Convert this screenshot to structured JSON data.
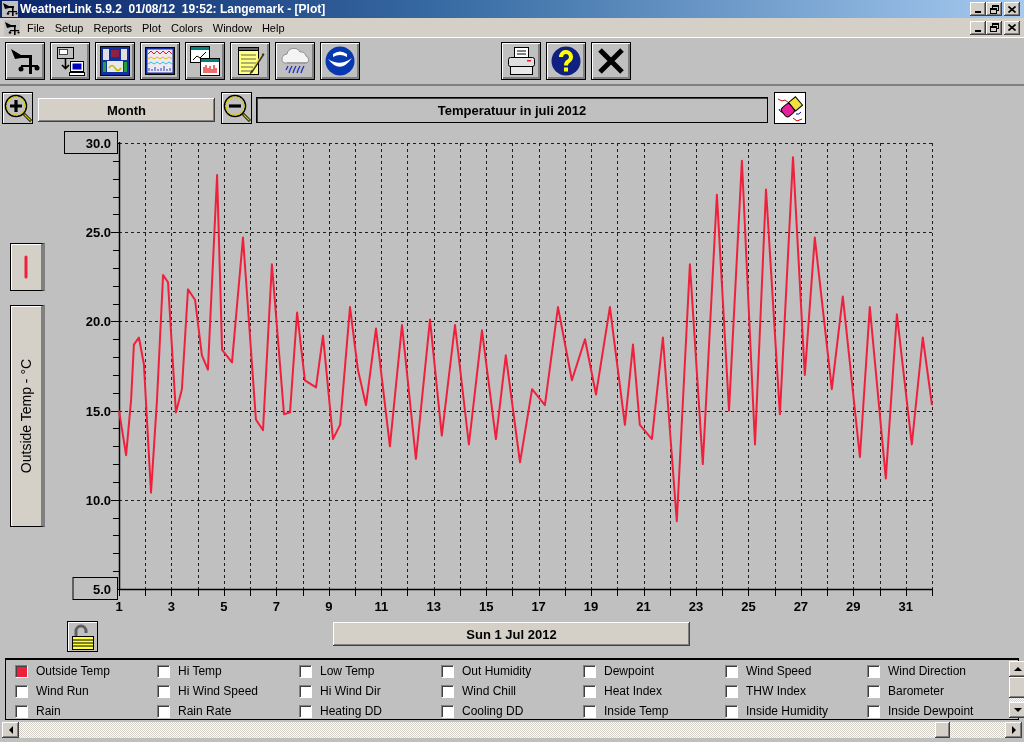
{
  "window": {
    "title": "WeatherLink 5.9.2  01/08/12  19:52: Langemark - [Plot]"
  },
  "menu": {
    "items": [
      "File",
      "Setup",
      "Reports",
      "Plot",
      "Colors",
      "Window",
      "Help"
    ]
  },
  "plot_controls": {
    "period_button": {
      "label": "Month"
    },
    "title_field": {
      "value": "Temperatuur in juli 2012"
    }
  },
  "chart": {
    "chart_data": {
      "type": "line",
      "ylabel": "Outside Temp - °C",
      "grid": true,
      "x": [
        1.0,
        1.27,
        1.46,
        1.57,
        1.76,
        1.95,
        2.22,
        2.45,
        2.68,
        2.87,
        3.17,
        3.4,
        3.63,
        3.9,
        4.16,
        4.39,
        4.74,
        4.93,
        5.31,
        5.73,
        6.22,
        6.49,
        6.83,
        7.29,
        7.52,
        7.79,
        8.09,
        8.51,
        8.78,
        9.16,
        9.43,
        9.81,
        10.11,
        10.42,
        10.8,
        11.33,
        11.79,
        12.32,
        12.86,
        13.31,
        13.81,
        14.34,
        14.84,
        15.37,
        15.75,
        16.29,
        16.75,
        17.24,
        17.74,
        18.27,
        18.77,
        19.19,
        19.72,
        20.29,
        20.6,
        20.86,
        21.32,
        21.74,
        22.27,
        22.77,
        23.26,
        23.8,
        24.26,
        24.75,
        25.25,
        25.67,
        26.2,
        26.7,
        27.15,
        27.53,
        28.18,
        28.6,
        29.25,
        29.63,
        30.24,
        30.66,
        31.23,
        31.65,
        32.0
      ],
      "series": [
        {
          "color": "#f0203c",
          "values": [
            15.0,
            12.5,
            15.6,
            18.7,
            19.1,
            17.6,
            10.4,
            15.6,
            22.6,
            22.2,
            14.9,
            16.2,
            21.8,
            21.2,
            18.1,
            17.3,
            28.2,
            18.4,
            17.7,
            24.7,
            14.5,
            13.9,
            23.2,
            14.8,
            14.9,
            20.5,
            16.7,
            16.3,
            19.2,
            13.4,
            14.2,
            20.8,
            17.3,
            15.3,
            19.6,
            13.0,
            19.8,
            12.3,
            20.1,
            13.6,
            19.8,
            13.1,
            19.5,
            13.4,
            18.1,
            12.1,
            16.2,
            15.3,
            20.8,
            16.7,
            19.0,
            15.9,
            20.8,
            14.2,
            18.7,
            14.2,
            13.4,
            19.1,
            8.8,
            23.2,
            12.0,
            27.1,
            15.0,
            29.0,
            13.1,
            27.4,
            14.8,
            29.2,
            17.0,
            24.7,
            16.2,
            21.4,
            12.4,
            20.8,
            11.2,
            20.4,
            13.1,
            19.1,
            15.3
          ]
        }
      ],
      "xlim": [
        1,
        32
      ],
      "ylim": [
        5,
        30
      ],
      "xticks": [
        1,
        3,
        5,
        7,
        9,
        11,
        13,
        15,
        17,
        19,
        21,
        23,
        25,
        27,
        29,
        31
      ],
      "yticks": [
        {
          "value": 5,
          "label": "5.0"
        },
        {
          "value": 10,
          "label": "10.0"
        },
        {
          "value": 15,
          "label": "15.0"
        },
        {
          "value": 20,
          "label": "20.0"
        },
        {
          "value": 25,
          "label": "25.0"
        },
        {
          "value": 30,
          "label": "30.0"
        }
      ]
    },
    "date_button": {
      "label": "Sun 1 Jul 2012"
    }
  },
  "legend": {
    "items": [
      {
        "label": "Outside Temp",
        "checked": true
      },
      {
        "label": "Hi Temp",
        "checked": false
      },
      {
        "label": "Low Temp",
        "checked": false
      },
      {
        "label": "Out Humidity",
        "checked": false
      },
      {
        "label": "Dewpoint",
        "checked": false
      },
      {
        "label": "Wind Speed",
        "checked": false
      },
      {
        "label": "Wind Direction",
        "checked": false
      },
      {
        "label": "Wind Run",
        "checked": false
      },
      {
        "label": "Hi Wind Speed",
        "checked": false
      },
      {
        "label": "Hi Wind Dir",
        "checked": false
      },
      {
        "label": "Wind Chill",
        "checked": false
      },
      {
        "label": "Heat Index",
        "checked": false
      },
      {
        "label": "THW Index",
        "checked": false
      },
      {
        "label": "Barometer",
        "checked": false
      },
      {
        "label": "Rain",
        "checked": false
      },
      {
        "label": "Rain Rate",
        "checked": false
      },
      {
        "label": "Heating DD",
        "checked": false
      },
      {
        "label": "Cooling DD",
        "checked": false
      },
      {
        "label": "Inside Temp",
        "checked": false
      },
      {
        "label": "Inside Humidity",
        "checked": false
      },
      {
        "label": "Inside Dewpoint",
        "checked": false
      }
    ]
  }
}
